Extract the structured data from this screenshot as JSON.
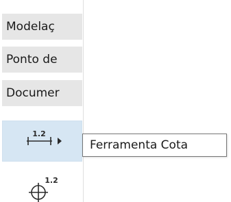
{
  "palette": {
    "tabs": [
      {
        "label": "Modelaç"
      },
      {
        "label": "Ponto de"
      },
      {
        "label": "Documer"
      }
    ],
    "tools": [
      {
        "icon": "linear-dimension-icon",
        "value_label": "1.2",
        "selected": true
      },
      {
        "icon": "center-mark-dimension-icon",
        "value_label": "1.2",
        "selected": false
      }
    ]
  },
  "tooltip": {
    "text": "Ferramenta Cota"
  },
  "colors": {
    "tab_background": "#e6e6e6",
    "selected_tool_background": "#d6e6f3",
    "tooltip_border": "#767676",
    "icon_color": "#2a2a2a"
  }
}
